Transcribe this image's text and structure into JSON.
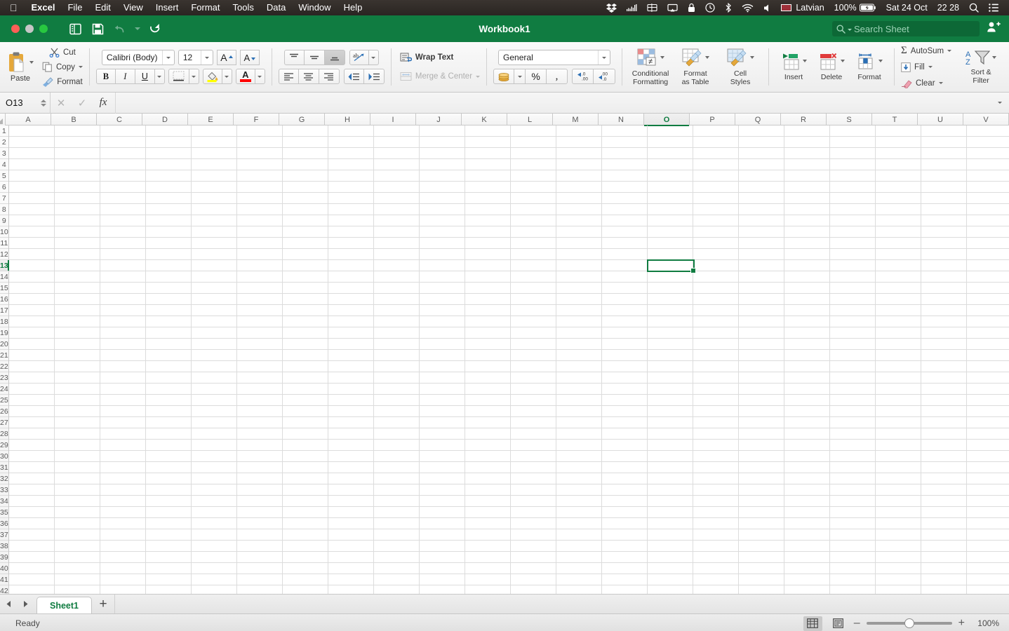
{
  "menubar": {
    "apple_icon": "apple-logo-icon",
    "items": [
      "Excel",
      "File",
      "Edit",
      "View",
      "Insert",
      "Format",
      "Tools",
      "Data",
      "Window",
      "Help"
    ],
    "status": {
      "icons": [
        "dropbox-icon",
        "signal-graph-icon",
        "display-arrangement-icon",
        "airplay-icon",
        "lock-icon",
        "time-machine-icon",
        "bluetooth-icon",
        "wifi-icon",
        "volume-icon"
      ],
      "flag": "latvian-flag-icon",
      "input_source": "Latvian",
      "battery_percent": "100%",
      "battery_icon": "battery-charging-icon",
      "date": "Sat 24 Oct",
      "time": "22 28",
      "search_icon": "spotlight-search-icon",
      "control_center_icon": "control-center-icon"
    }
  },
  "titlebar": {
    "title": "Workbook1",
    "buttons": [
      "close-button",
      "minimize-button",
      "maximize-button"
    ],
    "tools": [
      "sidebar-toggle-icon",
      "save-icon",
      "undo-icon",
      "redo-icon"
    ],
    "search_placeholder": "Search Sheet",
    "share_icon": "add-person-icon",
    "brand_color": "#107C41"
  },
  "ribbon": {
    "clipboard": {
      "paste_label": "Paste",
      "cut_label": "Cut",
      "copy_label": "Copy",
      "format_label": "Format"
    },
    "font": {
      "name": "Calibri (Body)",
      "size": "12",
      "grow_label": "A",
      "shrink_label": "A",
      "bold": "B",
      "italic": "I",
      "underline": "U",
      "fill_color": "#FFFF00",
      "font_color": "#FF0000"
    },
    "alignment": {
      "wrap_text": "Wrap Text",
      "merge_center": "Merge & Center",
      "vertical_selected": "bottom",
      "orientation_label": "ab"
    },
    "number": {
      "format": "General",
      "percent": "%",
      "comma": ",",
      "inc_dec": ".00",
      "dec_dec": ".00"
    },
    "styles": [
      {
        "label1": "Conditional",
        "label2": "Formatting",
        "icon": "conditional-formatting-icon"
      },
      {
        "label1": "Format",
        "label2": "as Table",
        "icon": "format-as-table-icon"
      },
      {
        "label1": "Cell",
        "label2": "Styles",
        "icon": "cell-styles-icon"
      }
    ],
    "cells": [
      {
        "label": "Insert",
        "icon": "insert-cells-icon"
      },
      {
        "label": "Delete",
        "icon": "delete-cells-icon"
      },
      {
        "label": "Format",
        "icon": "format-cells-icon"
      }
    ],
    "editing": {
      "autosum": "AutoSum",
      "fill": "Fill",
      "clear": "Clear",
      "sort_filter_1": "Sort &",
      "sort_filter_2": "Filter"
    }
  },
  "formulabar": {
    "namebox_value": "O13",
    "cancel_icon": "cancel-icon",
    "confirm_icon": "confirm-icon",
    "function_icon": "fx-icon",
    "formula_value": ""
  },
  "grid": {
    "columns": [
      "A",
      "B",
      "C",
      "D",
      "E",
      "F",
      "G",
      "H",
      "I",
      "J",
      "K",
      "L",
      "M",
      "N",
      "O",
      "P",
      "Q",
      "R",
      "S",
      "T",
      "U",
      "V"
    ],
    "rows": [
      1,
      2,
      3,
      4,
      5,
      6,
      7,
      8,
      9,
      10,
      11,
      12,
      13,
      14,
      15,
      16,
      17,
      18,
      19,
      20,
      21,
      22,
      23,
      24,
      25,
      26,
      27,
      28,
      29,
      30,
      31,
      32,
      33,
      34,
      35,
      36,
      37,
      38,
      39,
      40,
      41,
      42
    ],
    "selected_cell": "O13",
    "selected_column": "O",
    "selected_row": 13,
    "selection_color": "#107C41"
  },
  "sheetbar": {
    "prev_icon": "prev-sheet-icon",
    "next_icon": "next-sheet-icon",
    "tabs": [
      "Sheet1"
    ],
    "active_tab": "Sheet1",
    "add_label": "+"
  },
  "statusbar": {
    "status": "Ready",
    "views": [
      "normal-view-icon",
      "page-layout-view-icon"
    ],
    "active_view": "normal-view-icon",
    "zoom_minus": "–",
    "zoom_plus": "+",
    "zoom": "100%"
  }
}
